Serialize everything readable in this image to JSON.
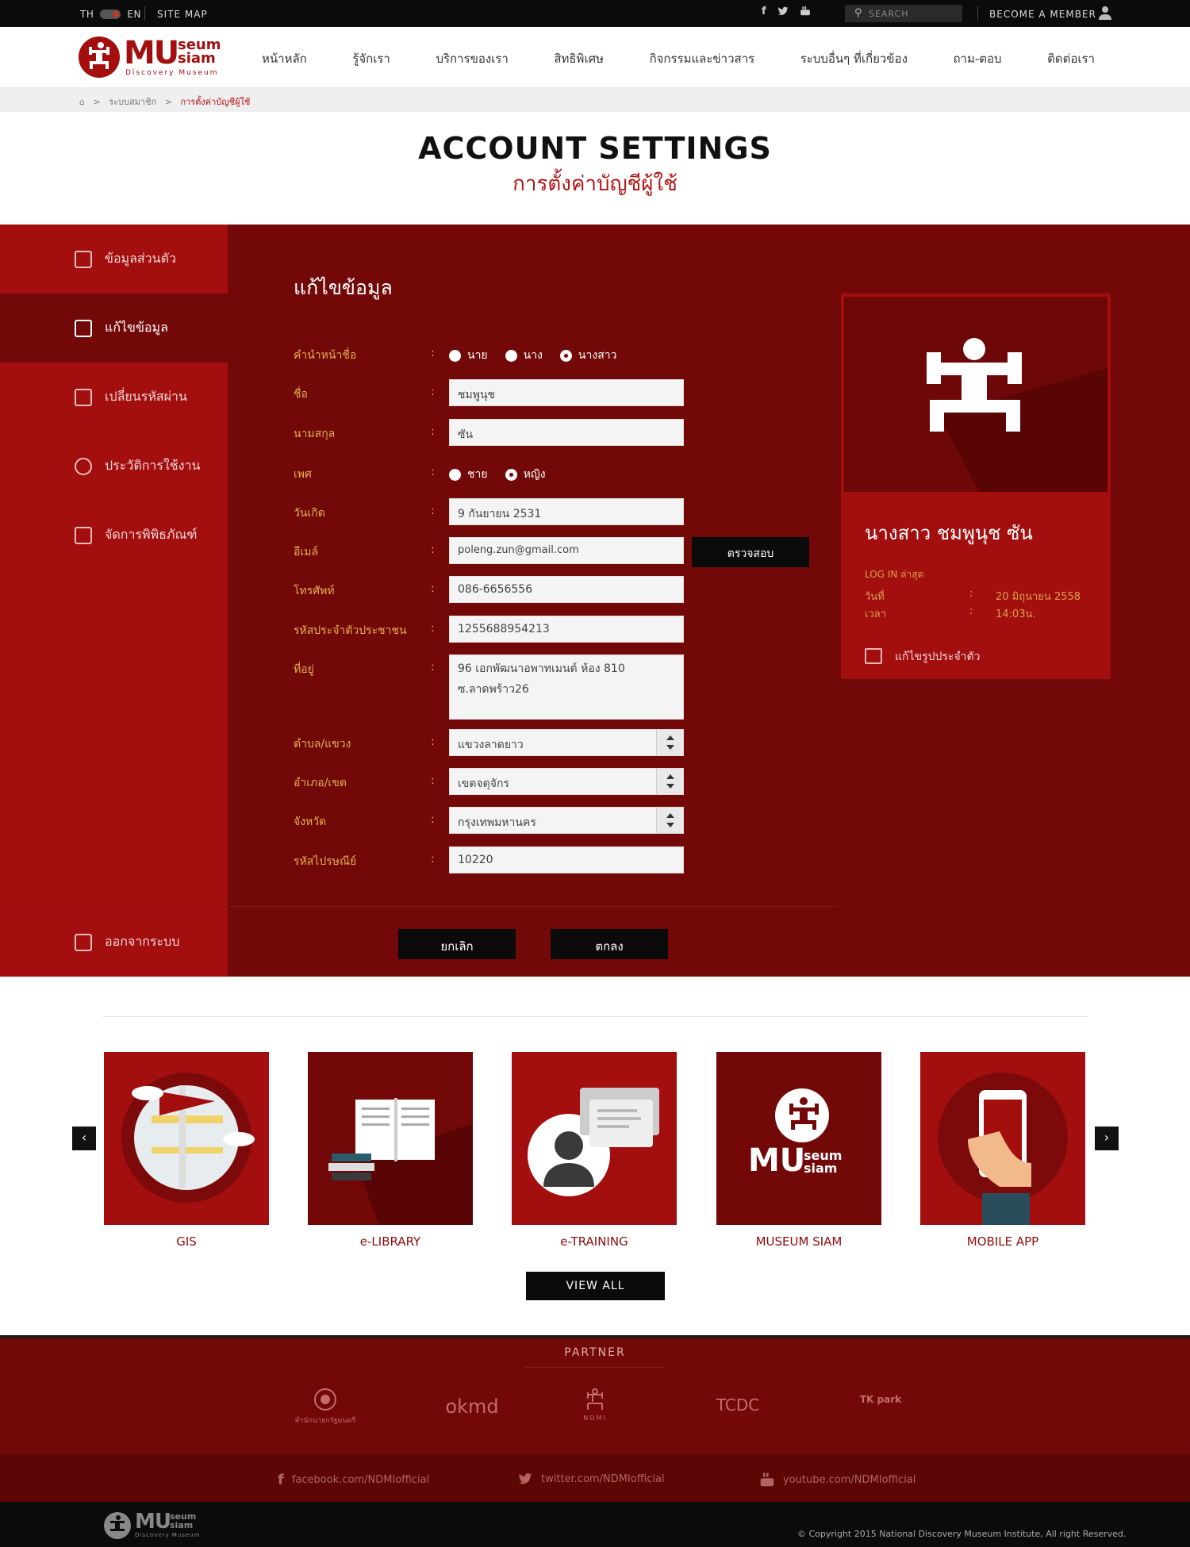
{
  "topbar": {
    "lang_th": "TH",
    "lang_en": "EN",
    "sitemap": "SITE MAP",
    "search_placeholder": "SEARCH",
    "member": "BECOME A MEMBER"
  },
  "logo": {
    "mu": "MU",
    "seum": "seum",
    "siam": "siam",
    "tagline": "Discovery Museum"
  },
  "nav": [
    "หน้าหลัก",
    "รู้จักเรา",
    "บริการของเรา",
    "สิทธิพิเศษ",
    "กิจกรรมและข่าวสาร",
    "ระบบอื่นๆ ที่เกี่ยวข้อง",
    "ถาม-ตอบ",
    "ติดต่อเรา"
  ],
  "breadcrumb": {
    "level1": "ระบบสมาชิก",
    "current": "การตั้งค่าบัญชีผู้ใช้"
  },
  "page": {
    "title_en": "ACCOUNT SETTINGS",
    "title_th": "การตั้งค่าบัญชีผู้ใช้"
  },
  "sidebar": {
    "items": [
      "ข้อมูลส่วนตัว",
      "แก้ไขข้อมูล",
      "เปลี่ยนรหัสผ่าน",
      "ประวัติการใช้งาน",
      "จัดการพิพิธภัณฑ์"
    ],
    "logout": "ออกจากระบบ"
  },
  "form": {
    "title": "แก้ไขข้อมูล",
    "colon": ":",
    "labels": {
      "prefix": "คำนำหน้าชื่อ",
      "firstname": "ชื่อ",
      "lastname": "นามสกุล",
      "gender": "เพศ",
      "birthday": "วันเกิด",
      "email": "อีเมล์",
      "phone": "โทรศัพท์",
      "idcard": "รหัสประจำตัวประชาชน",
      "address": "ที่อยู่",
      "subdistrict": "ตำบล/แขวง",
      "district": "อำเภอ/เขต",
      "province": "จังหวัด",
      "zipcode": "รหัสไปรษณีย์"
    },
    "prefix_options": [
      "นาย",
      "นาง",
      "นางสาว"
    ],
    "gender_options": [
      "ชาย",
      "หญิง"
    ],
    "values": {
      "firstname": "ชมพูนุช",
      "lastname": "ซัน",
      "birthday": "9 กันยายน 2531",
      "email": "poleng.zun@gmail.com",
      "phone": "086-6656556",
      "idcard": "1255688954213",
      "address_line1": "96 เอกพัฒนาอพาทเมนต์ ห้อง 810",
      "address_line2": "ซ.ลาดพร้าว26",
      "subdistrict": "แขวงลาดยาว",
      "district": "เขตจตุจักร",
      "province": "กรุงเทพมหานคร",
      "zipcode": "10220"
    },
    "verify_button": "ตรวจสอบ",
    "cancel_button": "ยกเลิก",
    "submit_button": "ตกลง"
  },
  "profile": {
    "name": "นางสาว ชมพูนุช ซัน",
    "last_login_label": "LOG IN ล่าสุด",
    "date_label": "วันที่",
    "date_value": "20 มิถุนายน 2558",
    "time_label": "เวลา",
    "time_value": "14:03น.",
    "edit_photo": "แก้ไขรูปประจำตัว"
  },
  "apps": [
    "GIS",
    "e-LIBRARY",
    "e-TRAINING",
    "MUSEUM SIAM",
    "MOBILE APP"
  ],
  "view_all": "VIEW ALL",
  "partner": {
    "title": "PARTNER",
    "items": [
      "สำนักนายกรัฐมนตรี",
      "okmd",
      "NDMI",
      "TCDC",
      "TK park"
    ]
  },
  "footer": {
    "facebook": "facebook.com/NDMIofficial",
    "twitter": "twitter.com/NDMIofficial",
    "youtube": "youtube.com/NDMIofficial",
    "copyright": "Copyright 2015 National Discovery Museum Institute, All right Reserved."
  },
  "colors": {
    "brand_red": "#a30e0e",
    "dark_red": "#720808",
    "label_gold": "#e4b24f",
    "black": "#0b0b0b"
  }
}
